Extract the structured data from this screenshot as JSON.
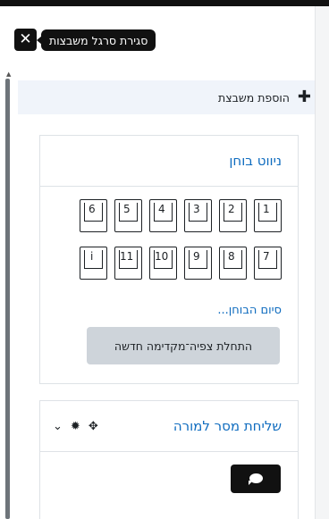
{
  "drawer": {
    "close_tooltip": "סגירת סרגל משבצות",
    "add_block_label": "הוספת משבצת"
  },
  "quiz_nav": {
    "title": "ניווט בוחן",
    "questions": [
      "1",
      "2",
      "3",
      "4",
      "5",
      "6",
      "7",
      "8",
      "9",
      "10",
      "11",
      "i"
    ],
    "finish_label": "סיום הבוחן...",
    "preview_label": "התחלת צפיה־מקדימה חדשה"
  },
  "message_block": {
    "title": "שליחת מסר למורה"
  },
  "icons": {
    "close": "close-icon",
    "add": "plus-icon",
    "move": "move-icon",
    "settings": "gear-icon",
    "collapse": "chevron-down-icon",
    "chat": "chat-bubble-icon"
  },
  "colors": {
    "link": "#0f6cbf",
    "button_bg": "#ced4da",
    "dark": "#111111"
  }
}
